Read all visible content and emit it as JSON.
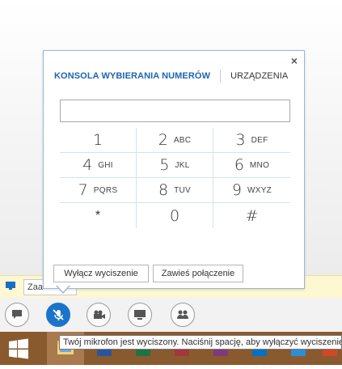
{
  "dialpad": {
    "tab_active": "KONSOLA WYBIERANIA NUMERÓW",
    "tab_inactive": "URZĄDZENIA",
    "close": "×",
    "number_value": "",
    "keys": [
      {
        "num": "1",
        "letters": ""
      },
      {
        "num": "2",
        "letters": "ABC"
      },
      {
        "num": "3",
        "letters": "DEF"
      },
      {
        "num": "4",
        "letters": "GHI"
      },
      {
        "num": "5",
        "letters": "JKL"
      },
      {
        "num": "6",
        "letters": "MNO"
      },
      {
        "num": "7",
        "letters": "PQRS"
      },
      {
        "num": "8",
        "letters": "TUV"
      },
      {
        "num": "9",
        "letters": "WXYZ"
      },
      {
        "num": "*",
        "letters": ""
      },
      {
        "num": "0",
        "letters": ""
      },
      {
        "num": "#",
        "letters": ""
      }
    ],
    "unmute_button": "Wyłącz wyciszenie",
    "hold_button": "Zawieś połączenie"
  },
  "notification": {
    "field_text": "Zaa"
  },
  "controls": {
    "chat": "chat-icon",
    "mic": "mic-muted-icon",
    "video": "video-camera-icon",
    "screen": "present-screen-icon",
    "people": "people-icon"
  },
  "tooltip": {
    "text": "Twój mikrofon jest wyciszony. Naciśnij spację, aby wyłączyć wyciszenie."
  },
  "colors": {
    "accent": "#1e64b4",
    "mic_active": "#1a74c9",
    "taskbar": "#8a5a2f"
  }
}
